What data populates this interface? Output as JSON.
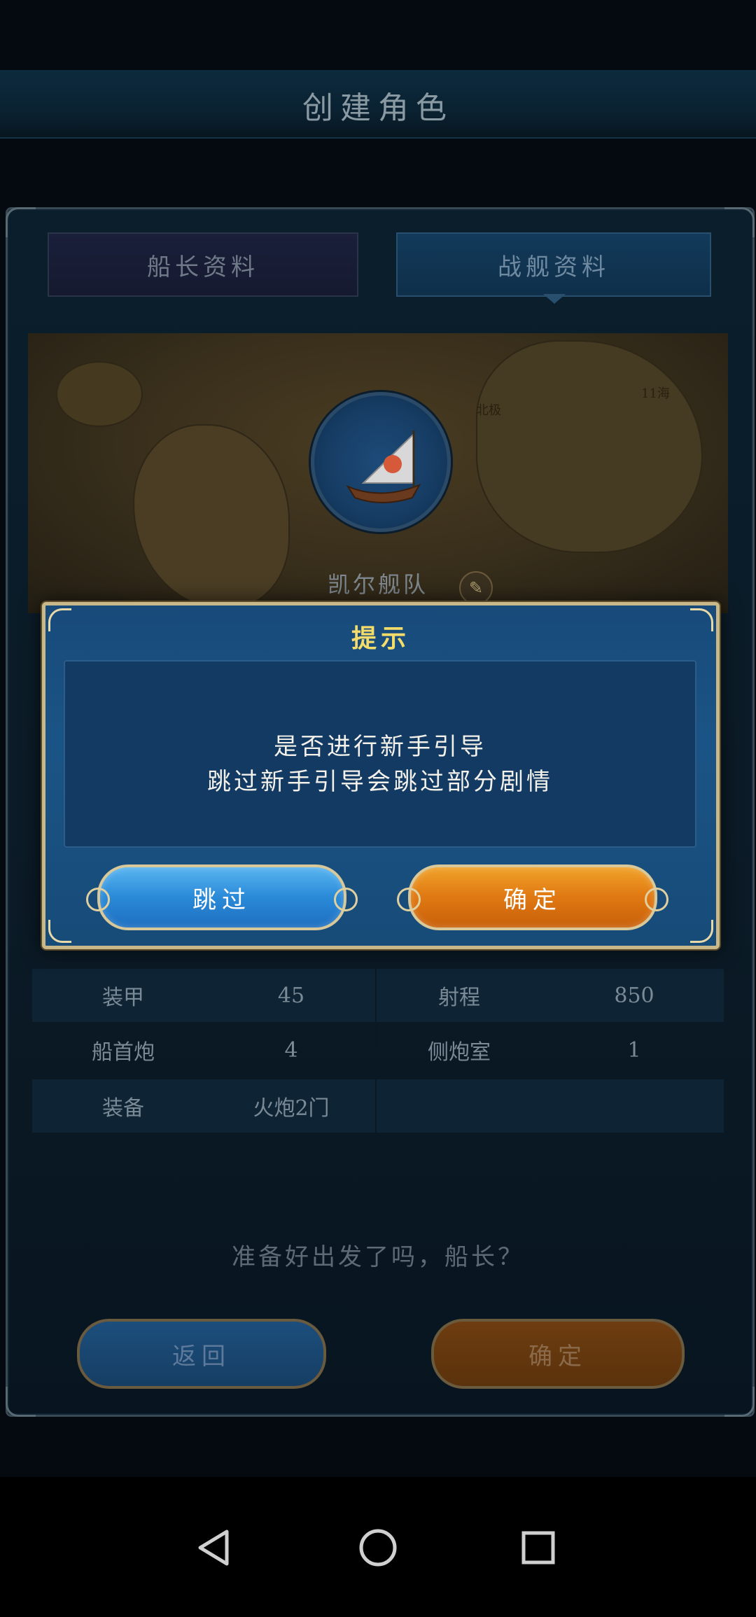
{
  "screen_title": "创建角色",
  "tabs": [
    {
      "label": "船长资料"
    },
    {
      "label": "战舰资料"
    }
  ],
  "map_labels": [
    "北极",
    "11海"
  ],
  "fleet": {
    "name": "凯尔舰队"
  },
  "stats": [
    {
      "label1": "装甲",
      "value1": "45",
      "label2": "射程",
      "value2": "850"
    },
    {
      "label1": "船首炮",
      "value1": "4",
      "label2": "侧炮室",
      "value2": "1"
    },
    {
      "label1": "装备",
      "value1": "火炮2门",
      "label2": "",
      "value2": ""
    }
  ],
  "ready_prompt": "准备好出发了吗，船长？",
  "bottom_buttons": {
    "back": "返回",
    "confirm": "确定"
  },
  "dialog": {
    "title": "提示",
    "message_line1": "是否进行新手引导",
    "message_line2": "跳过新手引导会跳过部分剧情",
    "skip_label": "跳过",
    "confirm_label": "确定"
  },
  "nav": [
    "back-icon",
    "home-icon",
    "recents-icon"
  ]
}
